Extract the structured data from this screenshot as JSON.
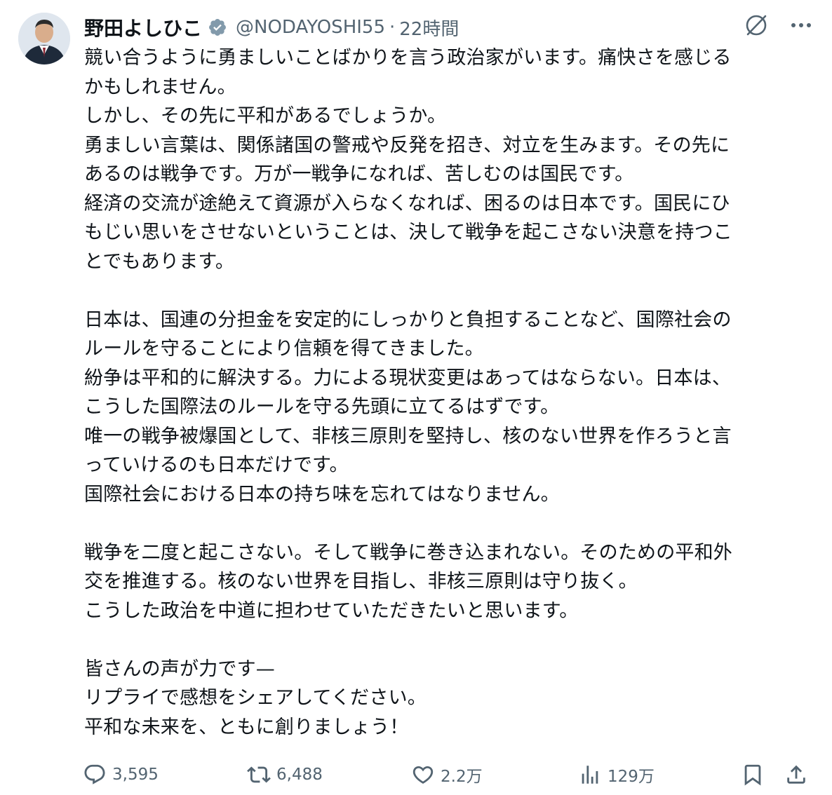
{
  "author": {
    "display_name": "野田よしひこ",
    "handle": "@NODAYOSHI55",
    "separator": "·",
    "time": "22時間"
  },
  "tweet": {
    "lines": [
      "競い合うように勇ましいことばかりを言う政治家がいます。痛快さを感じる",
      "かもしれません。",
      "しかし、その先に平和があるでしょうか。",
      "勇ましい言葉は、関係諸国の警戒や反発を招き、対立を生みます。その先に",
      "あるのは戦争です。万が一戦争になれば、苦しむのは国民です。",
      "経済の交流が途絶えて資源が入らなくなれば、困るのは日本です。国民にひ",
      "もじい思いをさせないということは、決して戦争を起こさない決意を持つこ",
      "とでもあります。",
      "",
      "日本は、国連の分担金を安定的にしっかりと負担することなど、国際社会の",
      "ルールを守ることにより信頼を得てきました。",
      "紛争は平和的に解決する。力による現状変更はあってはならない。日本は、",
      "こうした国際法のルールを守る先頭に立てるはずです。",
      "唯一の戦争被爆国として、非核三原則を堅持し、核のない世界を作ろうと言",
      "っていけるのも日本だけです。",
      "国際社会における日本の持ち味を忘れてはなりません。",
      "",
      "戦争を二度と起こさない。そして戦争に巻き込まれない。そのための平和外",
      "交を推進する。核のない世界を目指し、非核三原則は守り抜く。",
      "こうした政治を中道に担わせていただきたいと思います。",
      "",
      "皆さんの声が力です—",
      "リプライで感想をシェアしてください。",
      "平和な未来を、ともに創りましょう！"
    ]
  },
  "stats": {
    "replies": "3,595",
    "reposts": "6,488",
    "likes": "2.2万",
    "views": "129万"
  },
  "icons": {
    "verified": "verified-badge-icon",
    "grok": "grok-icon",
    "more": "more-icon",
    "reply": "reply-icon",
    "repost": "repost-icon",
    "like": "like-icon",
    "views": "views-icon",
    "bookmark": "bookmark-icon",
    "share": "share-icon"
  },
  "colors": {
    "text": "#0f1419",
    "secondary": "#536471",
    "verified": "#829aab"
  }
}
